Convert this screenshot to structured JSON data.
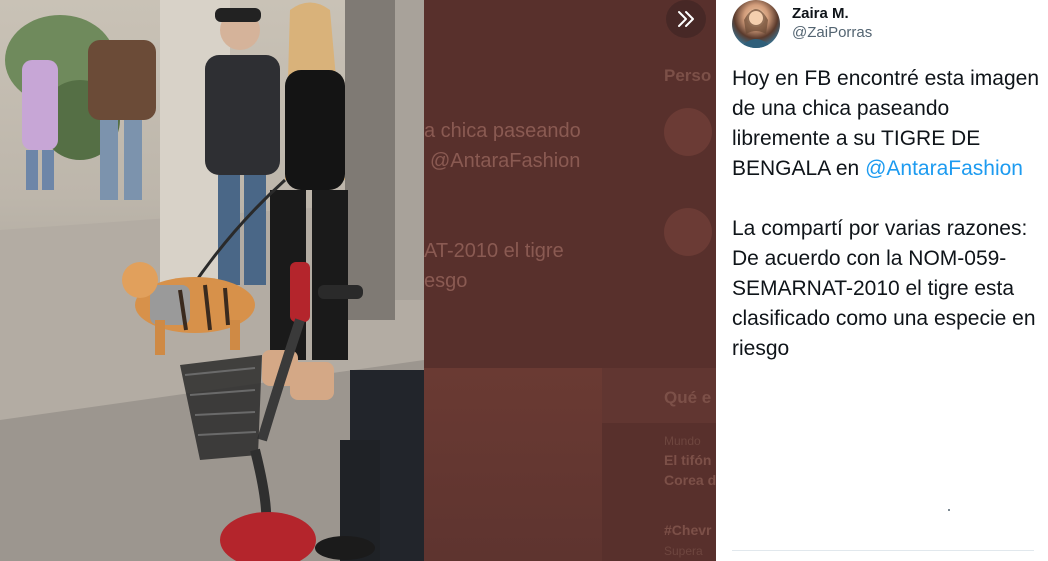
{
  "tweet": {
    "author_name": "Zaira M.",
    "author_handle": "@ZaiPorras",
    "text_part1": "Hoy en FB encontré esta imagen de una chica paseando libremente a su TIGRE DE BENGALA en ",
    "mention": "@AntaraFashion",
    "text_part2": "\n\nLa compartí por varias razones:\nDe acuerdo con la NOM-059-SEMARNAT-2010 el tigre esta clasificado como una especie en riesgo"
  },
  "background_page": {
    "line1": "a chica paseando",
    "line2": "@AntaraFashion",
    "line3": "AT-2010 el tigre",
    "line4": "esgo",
    "section1": "Perso",
    "section2": "Qué e",
    "trend_category": "Mundo",
    "trend_line1": "El tifón",
    "trend_line2": "Corea d",
    "hashtag": "#Chevr",
    "hashtag_sub": "Supera"
  },
  "icons": {
    "expand": "double-chevron-right-icon"
  },
  "colors": {
    "mention": "#1d9bf0",
    "overlay": "#58302c"
  }
}
